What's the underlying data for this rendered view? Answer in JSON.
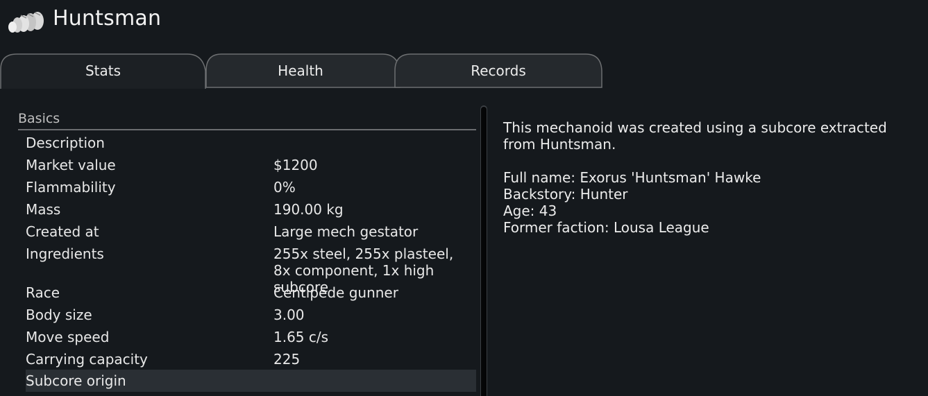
{
  "header": {
    "title": "Huntsman",
    "icon": "centipede-mech-icon"
  },
  "tabs": [
    {
      "label": "Stats",
      "active": true
    },
    {
      "label": "Health",
      "active": false
    },
    {
      "label": "Records",
      "active": false
    }
  ],
  "stats": {
    "section_title": "Basics",
    "rows": [
      {
        "label": "Description",
        "value": ""
      },
      {
        "label": "Market value",
        "value": "$1200"
      },
      {
        "label": "Flammability",
        "value": "0%"
      },
      {
        "label": "Mass",
        "value": "190.00 kg"
      },
      {
        "label": "Created at",
        "value": "Large mech gestator"
      },
      {
        "label": "Ingredients",
        "value": "255x steel, 255x plasteel, 8x component, 1x high subcore"
      },
      {
        "label": "Race",
        "value": "Centipede gunner"
      },
      {
        "label": "Body size",
        "value": "3.00"
      },
      {
        "label": "Move speed",
        "value": "1.65 c/s"
      },
      {
        "label": "Carrying capacity",
        "value": "225"
      },
      {
        "label": "Subcore origin",
        "value": ""
      }
    ]
  },
  "description": {
    "intro": "This mechanoid was created using a subcore extracted from Huntsman.",
    "full_name": "Full name: Exorus 'Huntsman' Hawke",
    "backstory": "Backstory: Hunter",
    "age": "Age: 43",
    "former_faction": "Former faction: Lousa League"
  },
  "colors": {
    "background": "#15191d",
    "tab_fill": "#25292d",
    "row_highlight": "#2a2f34"
  }
}
